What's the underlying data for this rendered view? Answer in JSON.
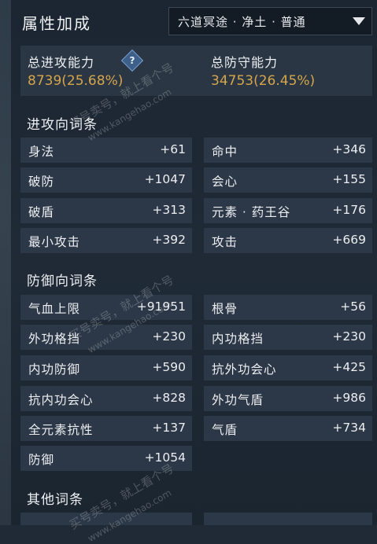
{
  "header": {
    "title": "属性加成",
    "dropdown_value": "六道冥途 · 净土 · 普通"
  },
  "totals": {
    "attack_label": "总进攻能力",
    "attack_value": "8739(25.68%)",
    "defense_label": "总防守能力",
    "defense_value": "34753(26.45%)",
    "help_glyph": "?"
  },
  "sections": {
    "attack_title": "进攻向词条",
    "defense_title": "防御向词条",
    "other_title": "其他词条"
  },
  "attack_stats": [
    {
      "label": "身法",
      "value": "+61"
    },
    {
      "label": "命中",
      "value": "+346"
    },
    {
      "label": "破防",
      "value": "+1047"
    },
    {
      "label": "会心",
      "value": "+155"
    },
    {
      "label": "破盾",
      "value": "+313"
    },
    {
      "label": "元素 · 药王谷",
      "value": "+176"
    },
    {
      "label": "最小攻击",
      "value": "+392"
    },
    {
      "label": "攻击",
      "value": "+669"
    }
  ],
  "defense_stats": [
    {
      "label": "气血上限",
      "value": "+91951"
    },
    {
      "label": "根骨",
      "value": "+56"
    },
    {
      "label": "外功格挡",
      "value": "+230"
    },
    {
      "label": "内功格挡",
      "value": "+230"
    },
    {
      "label": "内功防御",
      "value": "+590"
    },
    {
      "label": "抗外功会心",
      "value": "+425"
    },
    {
      "label": "抗内功会心",
      "value": "+828"
    },
    {
      "label": "外功气盾",
      "value": "+986"
    },
    {
      "label": "全元素抗性",
      "value": "+137"
    },
    {
      "label": "气盾",
      "value": "+734"
    },
    {
      "label": "防御",
      "value": "+1054"
    }
  ],
  "watermarks": {
    "wm1": "买号卖号，就上看个号",
    "wm1b": "www.kangehao.com",
    "wm2": "买号卖号，就上看个号",
    "wm2b": "www.kangehao.com",
    "wm3": "买号卖号，就上看个号",
    "wm3b": "www.kangehao.com"
  }
}
